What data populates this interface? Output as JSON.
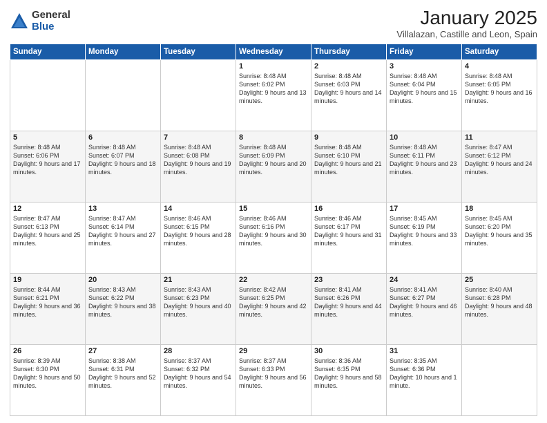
{
  "logo": {
    "general": "General",
    "blue": "Blue"
  },
  "header": {
    "title": "January 2025",
    "subtitle": "Villalazan, Castille and Leon, Spain"
  },
  "weekdays": [
    "Sunday",
    "Monday",
    "Tuesday",
    "Wednesday",
    "Thursday",
    "Friday",
    "Saturday"
  ],
  "weeks": [
    [
      {
        "day": "",
        "info": ""
      },
      {
        "day": "",
        "info": ""
      },
      {
        "day": "",
        "info": ""
      },
      {
        "day": "1",
        "info": "Sunrise: 8:48 AM\nSunset: 6:02 PM\nDaylight: 9 hours and 13 minutes."
      },
      {
        "day": "2",
        "info": "Sunrise: 8:48 AM\nSunset: 6:03 PM\nDaylight: 9 hours and 14 minutes."
      },
      {
        "day": "3",
        "info": "Sunrise: 8:48 AM\nSunset: 6:04 PM\nDaylight: 9 hours and 15 minutes."
      },
      {
        "day": "4",
        "info": "Sunrise: 8:48 AM\nSunset: 6:05 PM\nDaylight: 9 hours and 16 minutes."
      }
    ],
    [
      {
        "day": "5",
        "info": "Sunrise: 8:48 AM\nSunset: 6:06 PM\nDaylight: 9 hours and 17 minutes."
      },
      {
        "day": "6",
        "info": "Sunrise: 8:48 AM\nSunset: 6:07 PM\nDaylight: 9 hours and 18 minutes."
      },
      {
        "day": "7",
        "info": "Sunrise: 8:48 AM\nSunset: 6:08 PM\nDaylight: 9 hours and 19 minutes."
      },
      {
        "day": "8",
        "info": "Sunrise: 8:48 AM\nSunset: 6:09 PM\nDaylight: 9 hours and 20 minutes."
      },
      {
        "day": "9",
        "info": "Sunrise: 8:48 AM\nSunset: 6:10 PM\nDaylight: 9 hours and 21 minutes."
      },
      {
        "day": "10",
        "info": "Sunrise: 8:48 AM\nSunset: 6:11 PM\nDaylight: 9 hours and 23 minutes."
      },
      {
        "day": "11",
        "info": "Sunrise: 8:47 AM\nSunset: 6:12 PM\nDaylight: 9 hours and 24 minutes."
      }
    ],
    [
      {
        "day": "12",
        "info": "Sunrise: 8:47 AM\nSunset: 6:13 PM\nDaylight: 9 hours and 25 minutes."
      },
      {
        "day": "13",
        "info": "Sunrise: 8:47 AM\nSunset: 6:14 PM\nDaylight: 9 hours and 27 minutes."
      },
      {
        "day": "14",
        "info": "Sunrise: 8:46 AM\nSunset: 6:15 PM\nDaylight: 9 hours and 28 minutes."
      },
      {
        "day": "15",
        "info": "Sunrise: 8:46 AM\nSunset: 6:16 PM\nDaylight: 9 hours and 30 minutes."
      },
      {
        "day": "16",
        "info": "Sunrise: 8:46 AM\nSunset: 6:17 PM\nDaylight: 9 hours and 31 minutes."
      },
      {
        "day": "17",
        "info": "Sunrise: 8:45 AM\nSunset: 6:19 PM\nDaylight: 9 hours and 33 minutes."
      },
      {
        "day": "18",
        "info": "Sunrise: 8:45 AM\nSunset: 6:20 PM\nDaylight: 9 hours and 35 minutes."
      }
    ],
    [
      {
        "day": "19",
        "info": "Sunrise: 8:44 AM\nSunset: 6:21 PM\nDaylight: 9 hours and 36 minutes."
      },
      {
        "day": "20",
        "info": "Sunrise: 8:43 AM\nSunset: 6:22 PM\nDaylight: 9 hours and 38 minutes."
      },
      {
        "day": "21",
        "info": "Sunrise: 8:43 AM\nSunset: 6:23 PM\nDaylight: 9 hours and 40 minutes."
      },
      {
        "day": "22",
        "info": "Sunrise: 8:42 AM\nSunset: 6:25 PM\nDaylight: 9 hours and 42 minutes."
      },
      {
        "day": "23",
        "info": "Sunrise: 8:41 AM\nSunset: 6:26 PM\nDaylight: 9 hours and 44 minutes."
      },
      {
        "day": "24",
        "info": "Sunrise: 8:41 AM\nSunset: 6:27 PM\nDaylight: 9 hours and 46 minutes."
      },
      {
        "day": "25",
        "info": "Sunrise: 8:40 AM\nSunset: 6:28 PM\nDaylight: 9 hours and 48 minutes."
      }
    ],
    [
      {
        "day": "26",
        "info": "Sunrise: 8:39 AM\nSunset: 6:30 PM\nDaylight: 9 hours and 50 minutes."
      },
      {
        "day": "27",
        "info": "Sunrise: 8:38 AM\nSunset: 6:31 PM\nDaylight: 9 hours and 52 minutes."
      },
      {
        "day": "28",
        "info": "Sunrise: 8:37 AM\nSunset: 6:32 PM\nDaylight: 9 hours and 54 minutes."
      },
      {
        "day": "29",
        "info": "Sunrise: 8:37 AM\nSunset: 6:33 PM\nDaylight: 9 hours and 56 minutes."
      },
      {
        "day": "30",
        "info": "Sunrise: 8:36 AM\nSunset: 6:35 PM\nDaylight: 9 hours and 58 minutes."
      },
      {
        "day": "31",
        "info": "Sunrise: 8:35 AM\nSunset: 6:36 PM\nDaylight: 10 hours and 1 minute."
      },
      {
        "day": "",
        "info": ""
      }
    ]
  ]
}
